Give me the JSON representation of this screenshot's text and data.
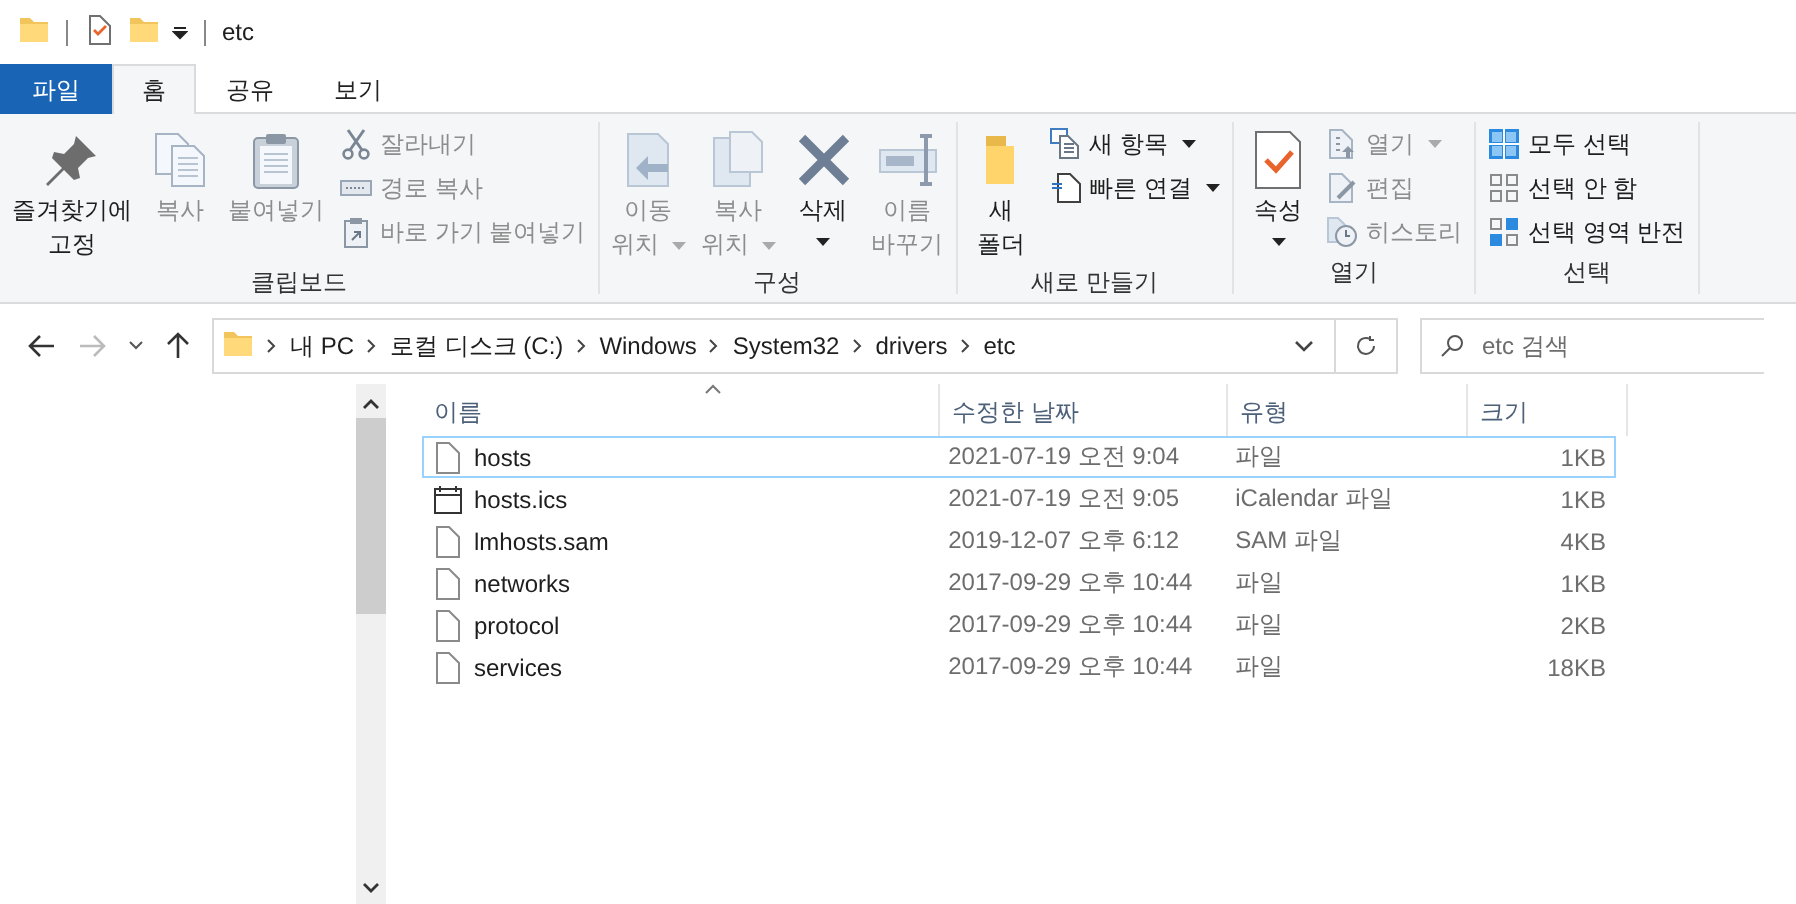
{
  "title_bar": {
    "title": "etc"
  },
  "tabs": [
    {
      "label": "파일",
      "kind": "file",
      "selected": false
    },
    {
      "label": "홈",
      "kind": "tab",
      "selected": true
    },
    {
      "label": "공유",
      "kind": "tab",
      "selected": false
    },
    {
      "label": "보기",
      "kind": "tab",
      "selected": false
    }
  ],
  "ribbon": {
    "groups": [
      {
        "label": "클립보드",
        "items": [
          {
            "kind": "large",
            "lines": [
              "즐겨찾기에",
              "고정"
            ],
            "disabled": false,
            "dropdown": false
          },
          {
            "kind": "large",
            "lines": [
              "복사"
            ],
            "disabled": true,
            "dropdown": false
          },
          {
            "kind": "large",
            "lines": [
              "붙여넣기"
            ],
            "disabled": true,
            "dropdown": false
          },
          {
            "kind": "small",
            "lines": [
              "잘라내기"
            ],
            "disabled": true,
            "dropdown": false
          },
          {
            "kind": "small",
            "lines": [
              "경로 복사"
            ],
            "disabled": true,
            "dropdown": false
          },
          {
            "kind": "small",
            "lines": [
              "바로 가기 붙여넣기"
            ],
            "disabled": true,
            "dropdown": false
          }
        ]
      },
      {
        "label": "구성",
        "items": [
          {
            "kind": "large",
            "lines": [
              "이동",
              "위치"
            ],
            "disabled": true,
            "dropdown": true
          },
          {
            "kind": "large",
            "lines": [
              "복사",
              "위치"
            ],
            "disabled": true,
            "dropdown": true
          },
          {
            "kind": "large",
            "lines": [
              "삭제"
            ],
            "disabled": false,
            "dropdown": true
          },
          {
            "kind": "large",
            "lines": [
              "이름",
              "바꾸기"
            ],
            "disabled": true,
            "dropdown": false
          }
        ]
      },
      {
        "label": "새로 만들기",
        "items": [
          {
            "kind": "large",
            "lines": [
              "새",
              "폴더"
            ],
            "disabled": false,
            "dropdown": false
          },
          {
            "kind": "small",
            "lines": [
              "새 항목"
            ],
            "disabled": false,
            "dropdown": true
          },
          {
            "kind": "small",
            "lines": [
              "빠른 연결"
            ],
            "disabled": false,
            "dropdown": true
          }
        ]
      },
      {
        "label": "열기",
        "items": [
          {
            "kind": "large",
            "lines": [
              "속성"
            ],
            "disabled": false,
            "dropdown": true
          },
          {
            "kind": "small",
            "lines": [
              "열기"
            ],
            "disabled": true,
            "dropdown": true
          },
          {
            "kind": "small",
            "lines": [
              "편집"
            ],
            "disabled": true,
            "dropdown": false
          },
          {
            "kind": "small",
            "lines": [
              "히스토리"
            ],
            "disabled": true,
            "dropdown": false
          }
        ]
      },
      {
        "label": "선택",
        "items": [
          {
            "kind": "small",
            "lines": [
              "모두 선택"
            ],
            "disabled": false,
            "dropdown": false
          },
          {
            "kind": "small",
            "lines": [
              "선택 안 함"
            ],
            "disabled": false,
            "dropdown": false
          },
          {
            "kind": "small",
            "lines": [
              "선택 영역 반전"
            ],
            "disabled": false,
            "dropdown": false
          }
        ]
      }
    ]
  },
  "address_bar": {
    "path": [
      "내 PC",
      "로컬 디스크 (C:)",
      "Windows",
      "System32",
      "drivers",
      "etc"
    ],
    "forward_disabled": true
  },
  "search": {
    "placeholder": "etc 검색"
  },
  "table": {
    "columns": [
      "이름",
      "수정한 날짜",
      "유형",
      "크기"
    ],
    "rows": [
      {
        "name": "hosts",
        "kind": "file",
        "date": "2021-07-19 오전 9:04",
        "type": "파일",
        "size": "1KB",
        "selected": true
      },
      {
        "name": "hosts.ics",
        "kind": "calendar",
        "date": "2021-07-19 오전 9:05",
        "type": "iCalendar 파일",
        "size": "1KB",
        "selected": false
      },
      {
        "name": "lmhosts.sam",
        "kind": "file",
        "date": "2019-12-07 오후 6:12",
        "type": "SAM 파일",
        "size": "4KB",
        "selected": false
      },
      {
        "name": "networks",
        "kind": "file",
        "date": "2017-09-29 오후 10:44",
        "type": "파일",
        "size": "1KB",
        "selected": false
      },
      {
        "name": "protocol",
        "kind": "file",
        "date": "2017-09-29 오후 10:44",
        "type": "파일",
        "size": "2KB",
        "selected": false
      },
      {
        "name": "services",
        "kind": "file",
        "date": "2017-09-29 오후 10:44",
        "type": "파일",
        "size": "18KB",
        "selected": false
      }
    ]
  }
}
